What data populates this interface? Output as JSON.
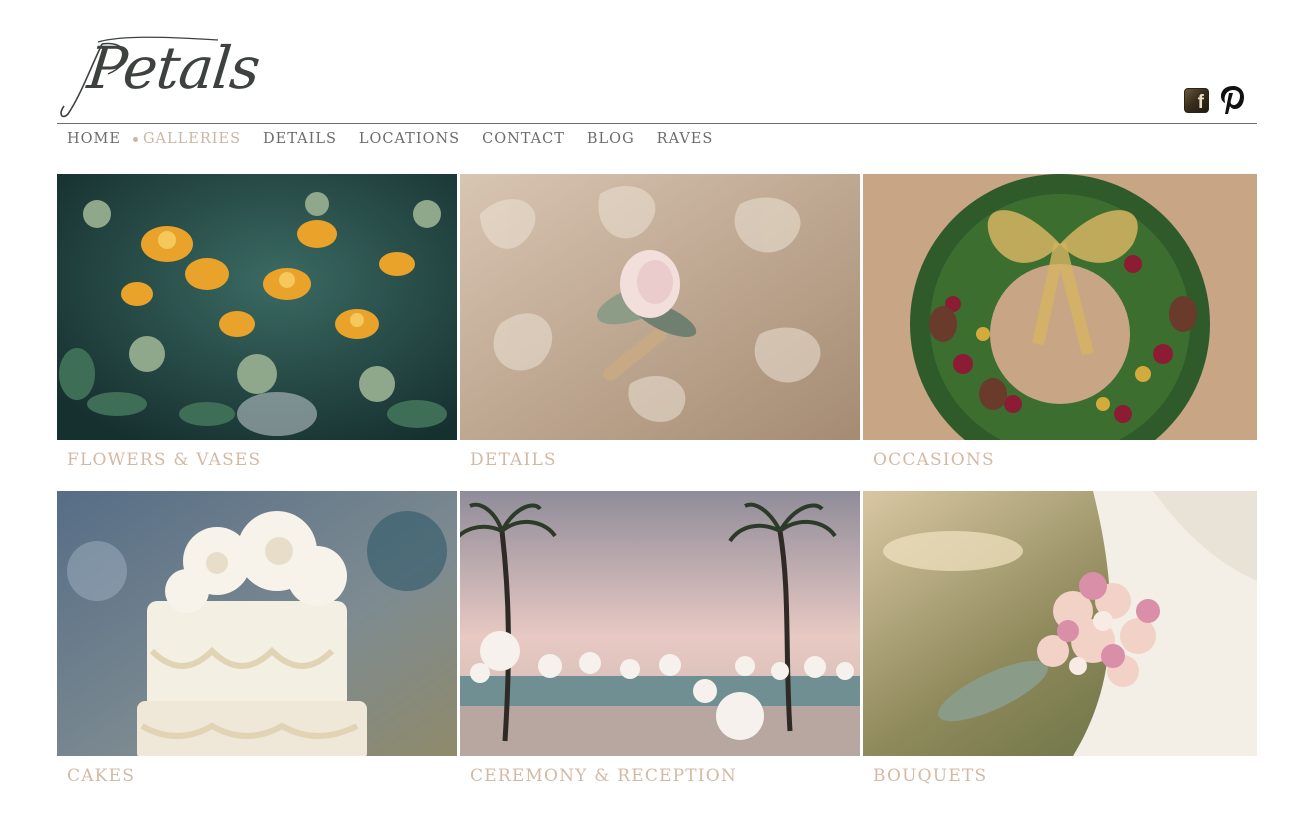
{
  "brand": {
    "logo_text": "Petals"
  },
  "social": [
    {
      "name": "facebook-icon",
      "glyph": "f"
    },
    {
      "name": "pinterest-icon"
    }
  ],
  "nav": {
    "items": [
      {
        "label": "HOME",
        "active": false
      },
      {
        "label": "GALLERIES",
        "active": true
      },
      {
        "label": "DETAILS",
        "active": false
      },
      {
        "label": "LOCATIONS",
        "active": false
      },
      {
        "label": "CONTACT",
        "active": false
      },
      {
        "label": "BLOG",
        "active": false
      },
      {
        "label": "RAVES",
        "active": false
      }
    ]
  },
  "galleries": [
    {
      "caption": "FLOWERS & VASES",
      "image": "orange-orchid-arrangement"
    },
    {
      "caption": "DETAILS",
      "image": "boutonniere-on-lace"
    },
    {
      "caption": "OCCASIONS",
      "image": "holiday-wreath"
    },
    {
      "caption": "CAKES",
      "image": "white-wedding-cake"
    },
    {
      "caption": "CEREMONY & RECEPTION",
      "image": "beach-reception-palms"
    },
    {
      "caption": "BOUQUETS",
      "image": "bridal-bouquet"
    }
  ],
  "colors": {
    "accent": "#d3b9a4",
    "nav_text": "#6c6c6c",
    "nav_active": "#c9b7a3",
    "logo": "#3e423f"
  }
}
